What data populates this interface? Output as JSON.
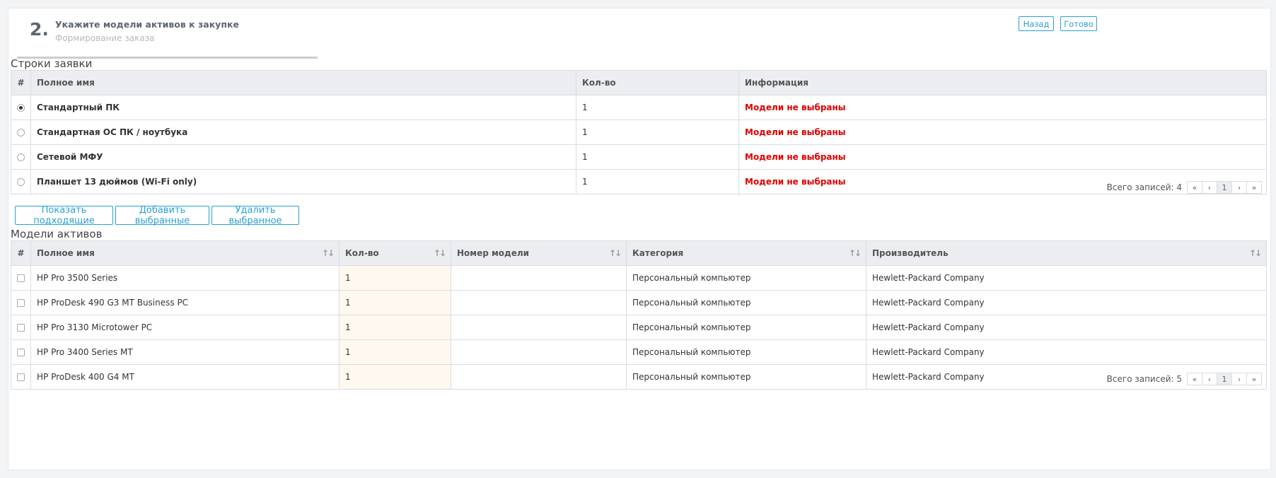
{
  "header": {
    "step_number": "2.",
    "step_title": "Укажите модели активов к закупке",
    "step_subtitle": "Формирование заказа",
    "back_label": "Назад",
    "done_label": "Готово"
  },
  "request_lines": {
    "title": "Строки заявки",
    "columns": [
      "#",
      "Полное имя",
      "Кол-во",
      "Информация"
    ],
    "rows": [
      {
        "selected": true,
        "name": "Стандартный ПК",
        "qty": "1",
        "info": "Модели не выбраны"
      },
      {
        "selected": false,
        "name": "Стандартная ОС ПК / ноутбука",
        "qty": "1",
        "info": "Модели не выбраны"
      },
      {
        "selected": false,
        "name": "Сетевой МФУ",
        "qty": "1",
        "info": "Модели не выбраны"
      },
      {
        "selected": false,
        "name": "Планшет 13 дюймов (Wi-Fi only)",
        "qty": "1",
        "info": "Модели не выбраны"
      }
    ],
    "pager": {
      "total": "Всего записей: 4",
      "page": "1",
      "first": "«",
      "prev": "‹",
      "next": "›",
      "last": "»"
    }
  },
  "actions": {
    "show_matching": "Показать подходящие",
    "add_selected": "Добавить выбранные",
    "remove_selected": "Удалить выбранное"
  },
  "asset_models": {
    "title": "Модели активов",
    "columns": [
      "#",
      "Полное имя",
      "Кол-во",
      "Номер модели",
      "Категория",
      "Производитель"
    ],
    "rows": [
      {
        "name": "HP Pro 3500 Series",
        "qty": "1",
        "model_no": "",
        "category": "Персональный компьютер",
        "vendor": "Hewlett-Packard Company"
      },
      {
        "name": "HP ProDesk 490 G3 MT Business PC",
        "qty": "1",
        "model_no": "",
        "category": "Персональный компьютер",
        "vendor": "Hewlett-Packard Company"
      },
      {
        "name": "HP Pro 3130 Microtower PC",
        "qty": "1",
        "model_no": "",
        "category": "Персональный компьютер",
        "vendor": "Hewlett-Packard Company"
      },
      {
        "name": "HP Pro 3400 Series MT",
        "qty": "1",
        "model_no": "",
        "category": "Персональный компьютер",
        "vendor": "Hewlett-Packard Company"
      },
      {
        "name": "HP ProDesk 400 G4 MT",
        "qty": "1",
        "model_no": "",
        "category": "Персональный компьютер",
        "vendor": "Hewlett-Packard Company"
      }
    ],
    "sort_icon": "sort-icon",
    "pager": {
      "total": "Всего записей: 5",
      "page": "1",
      "first": "«",
      "prev": "‹",
      "next": "›",
      "last": "»"
    }
  },
  "colors": {
    "accent": "#2a9fd6",
    "error": "#e00000",
    "qty_highlight": "#fff8ef"
  }
}
